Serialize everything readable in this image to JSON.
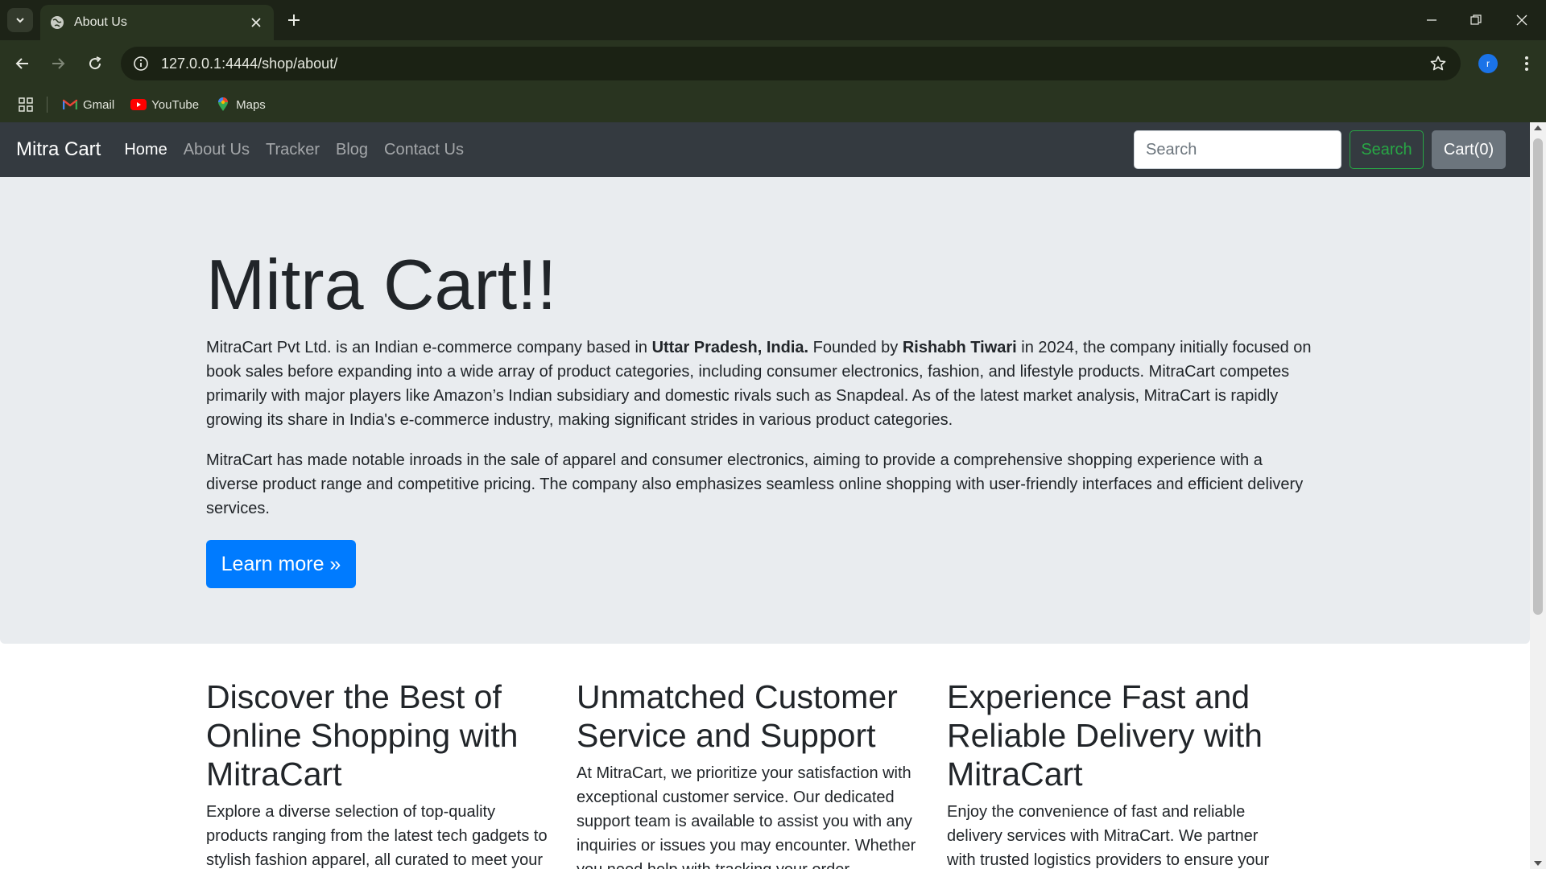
{
  "browser": {
    "tab_title": "About Us",
    "url": "127.0.0.1:4444/shop/about/",
    "profile_initial": "r",
    "bookmarks": [
      {
        "label": "Gmail",
        "icon": "gmail-icon"
      },
      {
        "label": "YouTube",
        "icon": "youtube-icon"
      },
      {
        "label": "Maps",
        "icon": "maps-icon"
      }
    ]
  },
  "navbar": {
    "brand": "Mitra Cart",
    "links": [
      {
        "label": "Home",
        "active": true
      },
      {
        "label": "About Us",
        "active": false
      },
      {
        "label": "Tracker",
        "active": false
      },
      {
        "label": "Blog",
        "active": false
      },
      {
        "label": "Contact Us",
        "active": false
      }
    ],
    "search_placeholder": "Search",
    "search_button": "Search",
    "cart_button": "Cart(0)"
  },
  "jumbotron": {
    "title": "Mitra Cart!!",
    "p1_part1": "MitraCart Pvt Ltd. is an Indian e-commerce company based in ",
    "p1_bold1": "Uttar Pradesh, India.",
    "p1_part2": " Founded by ",
    "p1_bold2": "Rishabh Tiwari",
    "p1_part3": " in 2024, the company initially focused on book sales before expanding into a wide array of product categories, including consumer electronics, fashion, and lifestyle products. MitraCart competes primarily with major players like Amazon’s Indian subsidiary and domestic rivals such as Snapdeal. As of the latest market analysis, MitraCart is rapidly growing its share in India's e-commerce industry, making significant strides in various product categories.",
    "p2": "MitraCart has made notable inroads in the sale of apparel and consumer electronics, aiming to provide a comprehensive shopping experience with a diverse product range and competitive pricing. The company also emphasizes seamless online shopping with user-friendly interfaces and efficient delivery services.",
    "button": "Learn more »"
  },
  "features": [
    {
      "heading": "Discover the Best of Online Shopping with MitraCart",
      "text": "Explore a diverse selection of top-quality products ranging from the latest tech gadgets to stylish fashion apparel, all curated to meet your"
    },
    {
      "heading": "Unmatched Customer Service and Support",
      "text": "At MitraCart, we prioritize your satisfaction with exceptional customer service. Our dedicated support team is available to assist you with any inquiries or issues you may encounter. Whether you need help with tracking your order"
    },
    {
      "heading": "Experience Fast and Reliable Delivery with MitraCart",
      "text": "Enjoy the convenience of fast and reliable delivery services with MitraCart. We partner with trusted logistics providers to ensure your orders"
    }
  ],
  "colors": {
    "navbar_bg": "#343a40",
    "jumbotron_bg": "#e9ecef",
    "primary": "#007bff",
    "success": "#28a745",
    "secondary": "#6c757d",
    "chrome_tabbar": "#1d2317",
    "chrome_toolbar": "#293420"
  }
}
